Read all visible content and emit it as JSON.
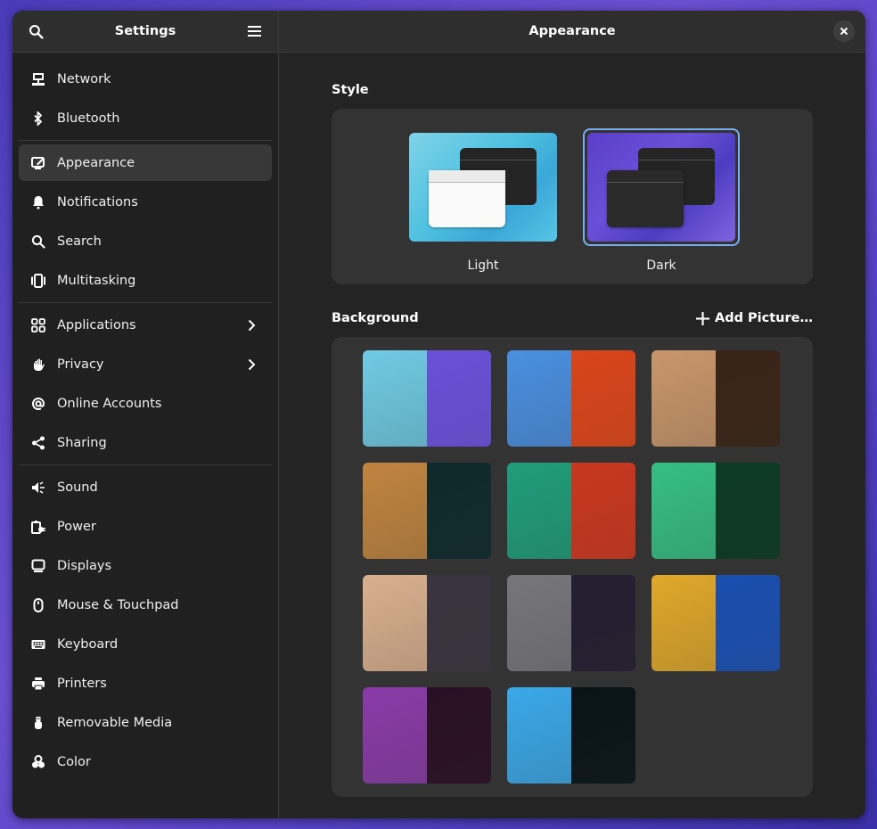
{
  "sidebar": {
    "title": "Settings",
    "search_icon": "search-icon",
    "menu_icon": "hamburger-menu-icon",
    "groups": [
      [
        {
          "label": "Network",
          "icon": "network-icon"
        },
        {
          "label": "Bluetooth",
          "icon": "bluetooth-icon"
        }
      ],
      [
        {
          "label": "Appearance",
          "icon": "appearance-icon",
          "selected": true
        },
        {
          "label": "Notifications",
          "icon": "bell-icon"
        },
        {
          "label": "Search",
          "icon": "search-icon"
        },
        {
          "label": "Multitasking",
          "icon": "multitasking-icon"
        }
      ],
      [
        {
          "label": "Applications",
          "icon": "apps-grid-icon",
          "chevron": true
        },
        {
          "label": "Privacy",
          "icon": "hand-icon",
          "chevron": true
        },
        {
          "label": "Online Accounts",
          "icon": "at-sign-icon"
        },
        {
          "label": "Sharing",
          "icon": "share-icon"
        }
      ],
      [
        {
          "label": "Sound",
          "icon": "speaker-icon"
        },
        {
          "label": "Power",
          "icon": "power-icon"
        },
        {
          "label": "Displays",
          "icon": "display-icon"
        },
        {
          "label": "Mouse & Touchpad",
          "icon": "mouse-icon"
        },
        {
          "label": "Keyboard",
          "icon": "keyboard-icon"
        },
        {
          "label": "Printers",
          "icon": "printer-icon"
        },
        {
          "label": "Removable Media",
          "icon": "usb-icon"
        },
        {
          "label": "Color",
          "icon": "color-icon"
        }
      ]
    ]
  },
  "main": {
    "title": "Appearance",
    "close_icon": "close-icon",
    "style": {
      "heading": "Style",
      "options": [
        {
          "label": "Light",
          "selected": false
        },
        {
          "label": "Dark",
          "selected": true
        }
      ]
    },
    "background": {
      "heading": "Background",
      "add_label": "Add Picture…",
      "wallpapers": [
        {
          "light": "#6fcbe3",
          "dark": "#6a50d8"
        },
        {
          "light": "#4a8fe0",
          "dark": "#d9451a"
        },
        {
          "light": "#c9966a",
          "dark": "#3a2418"
        },
        {
          "light": "#c0843f",
          "dark": "#0f2a2c"
        },
        {
          "light": "#1f9d7a",
          "dark": "#c8371f"
        },
        {
          "light": "#35bf82",
          "dark": "#0c3a22"
        },
        {
          "light": "#d9b08e",
          "dark": "#3a3440"
        },
        {
          "light": "#77767b",
          "dark": "#241f31"
        },
        {
          "light": "#e0a82a",
          "dark": "#1a4fb0"
        },
        {
          "light": "#8a3aa8",
          "dark": "#2a1024"
        },
        {
          "light": "#3aa8e8",
          "dark": "#0a1418"
        }
      ]
    }
  },
  "colors": {
    "accent": "#78aeed",
    "window_bg": "#242424",
    "sidebar_bg": "#202020",
    "card_bg": "#333333"
  }
}
